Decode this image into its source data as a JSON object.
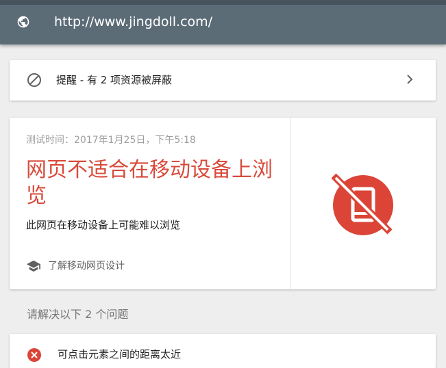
{
  "header": {
    "url": "http://www.jingdoll.com/",
    "globe_icon": "globe-icon"
  },
  "alert": {
    "icon": "block-icon",
    "text": "提醒 - 有 2 项资源被屏蔽",
    "chevron_icon": "chevron-right-icon"
  },
  "result": {
    "test_time": "测试时间：2017年1月25日，下午5:18",
    "title": "网页不适合在移动设备上浏览",
    "description": "此网页在移动设备上可能难以浏览",
    "learn_link": "了解移动网页设计",
    "learn_icon": "school-icon",
    "status_icon": "mobile-off-icon",
    "status_color": "#db4437"
  },
  "issues": {
    "heading": "请解决以下 2 个问题",
    "items": [
      {
        "text": "可点击元素之间的距离太近",
        "icon": "error-icon"
      }
    ]
  },
  "colors": {
    "header_bg": "#5c6c77",
    "error_red": "#db4437",
    "title_red": "#d84a3b"
  }
}
